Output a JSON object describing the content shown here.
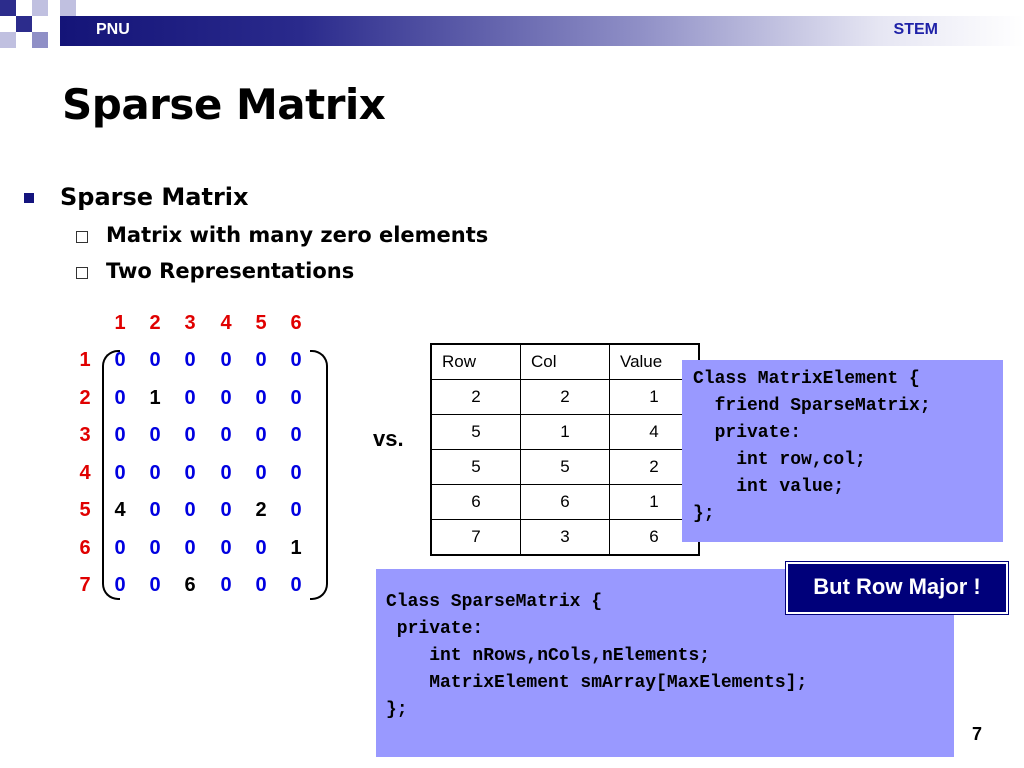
{
  "header": {
    "left": "PNU",
    "right": "STEM"
  },
  "title": "Sparse Matrix",
  "bullets": {
    "main": "Sparse Matrix",
    "sub1": "Matrix with many zero elements",
    "sub2": "Two Representations"
  },
  "matrix": {
    "col_labels": [
      "1",
      "2",
      "3",
      "4",
      "5",
      "6"
    ],
    "row_labels": [
      "1",
      "2",
      "3",
      "4",
      "5",
      "6",
      "7"
    ],
    "rows": [
      [
        "0",
        "0",
        "0",
        "0",
        "0",
        "0"
      ],
      [
        "0",
        "1",
        "0",
        "0",
        "0",
        "0"
      ],
      [
        "0",
        "0",
        "0",
        "0",
        "0",
        "0"
      ],
      [
        "0",
        "0",
        "0",
        "0",
        "0",
        "0"
      ],
      [
        "4",
        "0",
        "0",
        "0",
        "2",
        "0"
      ],
      [
        "0",
        "0",
        "0",
        "0",
        "0",
        "1"
      ],
      [
        "0",
        "0",
        "6",
        "0",
        "0",
        "0"
      ]
    ],
    "colors": {
      "label": "#e00000",
      "zero": "#0000e0",
      "nonzero": "#000000"
    }
  },
  "vs_label": "vs.",
  "triplet_table": {
    "headers": [
      "Row",
      "Col",
      "Value"
    ],
    "rows": [
      [
        "2",
        "2",
        "1"
      ],
      [
        "5",
        "1",
        "4"
      ],
      [
        "5",
        "5",
        "2"
      ],
      [
        "6",
        "6",
        "1"
      ],
      [
        "7",
        "3",
        "6"
      ]
    ]
  },
  "code_element": "Class MatrixElement {\n  friend SparseMatrix;\n  private:\n    int row,col;\n    int value;\n};",
  "code_sparse": "Class SparseMatrix {\n private:\n    int nRows,nCols,nElements;\n    MatrixElement smArray[MaxElements];\n};",
  "callout": "But Row Major !",
  "page_number": "7",
  "colors": {
    "navy": "#14147e",
    "code_bg": "#9999ff",
    "callout_bg": "#00007a"
  }
}
